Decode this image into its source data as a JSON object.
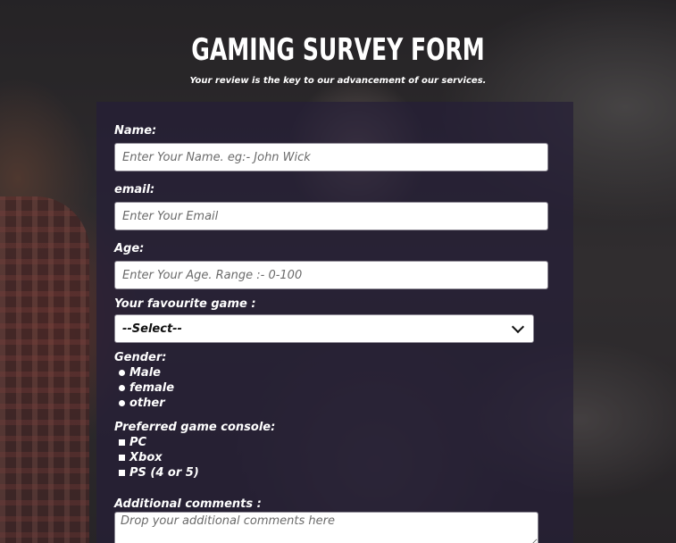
{
  "header": {
    "title": "GAMING SURVEY FORM",
    "subtitle": "Your review is the key to our advancement of our services."
  },
  "form": {
    "name": {
      "label": "Name:",
      "placeholder": "Enter Your Name. eg:- John Wick",
      "value": ""
    },
    "email": {
      "label": "email:",
      "placeholder": "Enter Your Email",
      "value": ""
    },
    "age": {
      "label": "Age:",
      "placeholder": "Enter Your Age. Range :- 0-100",
      "value": ""
    },
    "favourite_game": {
      "label": "Your favourite game :",
      "selected": "--Select--"
    },
    "gender": {
      "label": "Gender:",
      "options": [
        "Male",
        "female",
        "other"
      ]
    },
    "console": {
      "label": "Preferred game console:",
      "options": [
        "PC",
        "Xbox",
        "PS (4 or 5)"
      ]
    },
    "comments": {
      "label": "Additional comments :",
      "placeholder": "Drop your additional comments here",
      "value": ""
    }
  },
  "colors": {
    "panel": "#261e38",
    "text": "#ffffff",
    "input_bg": "#ffffff"
  }
}
